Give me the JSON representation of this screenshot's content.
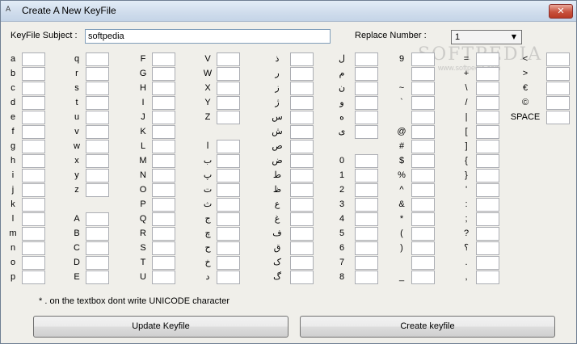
{
  "window": {
    "title": "Create A New KeyFile",
    "close_glyph": "✕",
    "icon_glyph": "A"
  },
  "subject": {
    "label": "KeyFile Subject :",
    "value": "softpedia"
  },
  "replace": {
    "label": "Replace Number :",
    "selected": "1",
    "arrow": "▼"
  },
  "watermark": {
    "text": "SOFTPEDIA",
    "url": "www.softpedia.com"
  },
  "columns": [
    {
      "slots": [
        [
          "a",
          0
        ],
        [
          "b",
          1
        ],
        [
          "c",
          2
        ],
        [
          "d",
          3
        ],
        [
          "e",
          4
        ],
        [
          "f",
          5
        ],
        [
          "g",
          6
        ],
        [
          "h",
          7
        ],
        [
          "i",
          8
        ],
        [
          "j",
          9
        ],
        [
          "k",
          10
        ],
        [
          "l",
          11
        ],
        [
          "m",
          12
        ],
        [
          "n",
          13
        ],
        [
          "o",
          14
        ],
        [
          "p",
          15
        ]
      ]
    },
    {
      "slots": [
        [
          "q",
          0
        ],
        [
          "r",
          1
        ],
        [
          "s",
          2
        ],
        [
          "t",
          3
        ],
        [
          "u",
          4
        ],
        [
          "v",
          5
        ],
        [
          "w",
          6
        ],
        [
          "x",
          7
        ],
        [
          "y",
          8
        ],
        [
          "z",
          9
        ],
        [
          "A",
          11
        ],
        [
          "B",
          12
        ],
        [
          "C",
          13
        ],
        [
          "D",
          14
        ],
        [
          "E",
          15
        ]
      ]
    },
    {
      "slots": [
        [
          "F",
          0
        ],
        [
          "G",
          1
        ],
        [
          "H",
          2
        ],
        [
          "I",
          3
        ],
        [
          "J",
          4
        ],
        [
          "K",
          5
        ],
        [
          "L",
          6
        ],
        [
          "M",
          7
        ],
        [
          "N",
          8
        ],
        [
          "O",
          9
        ],
        [
          "P",
          10
        ],
        [
          "Q",
          11
        ],
        [
          "R",
          12
        ],
        [
          "S",
          13
        ],
        [
          "T",
          14
        ],
        [
          "U",
          15
        ]
      ]
    },
    {
      "slots": [
        [
          "V",
          0
        ],
        [
          "W",
          1
        ],
        [
          "X",
          2
        ],
        [
          "Y",
          3
        ],
        [
          "Z",
          4
        ],
        [
          "ا",
          6
        ],
        [
          "ب",
          7
        ],
        [
          "پ",
          8
        ],
        [
          "ت",
          9
        ],
        [
          "ث",
          10
        ],
        [
          "ج",
          11
        ],
        [
          "چ",
          12
        ],
        [
          "ح",
          13
        ],
        [
          "خ",
          14
        ],
        [
          "د",
          15
        ]
      ]
    },
    {
      "slots": [
        [
          "ذ",
          0
        ],
        [
          "ر",
          1
        ],
        [
          "ز",
          2
        ],
        [
          "ژ",
          3
        ],
        [
          "س",
          4
        ],
        [
          "ش",
          5
        ],
        [
          "ص",
          6
        ],
        [
          "ض",
          7
        ],
        [
          "ط",
          8
        ],
        [
          "ظ",
          9
        ],
        [
          "ع",
          10
        ],
        [
          "غ",
          11
        ],
        [
          "ف",
          12
        ],
        [
          "ق",
          13
        ],
        [
          "ک",
          14
        ],
        [
          "گ",
          15
        ]
      ]
    },
    {
      "slots": [
        [
          "ل",
          0
        ],
        [
          "م",
          1
        ],
        [
          "ن",
          2
        ],
        [
          "و",
          3
        ],
        [
          "ه",
          4
        ],
        [
          "ی",
          5
        ],
        [
          "0",
          7
        ],
        [
          "1",
          8
        ],
        [
          "2",
          9
        ],
        [
          "3",
          10
        ],
        [
          "4",
          11
        ],
        [
          "5",
          12
        ],
        [
          "6",
          13
        ],
        [
          "7",
          14
        ],
        [
          "8",
          15
        ]
      ]
    },
    {
      "slots": [
        [
          "9",
          0
        ],
        [
          "",
          1
        ],
        [
          "~",
          2
        ],
        [
          "`",
          3
        ],
        [
          "",
          4
        ],
        [
          "@",
          5
        ],
        [
          "#",
          6
        ],
        [
          "$",
          7
        ],
        [
          "%",
          8
        ],
        [
          "^",
          9
        ],
        [
          "&",
          10
        ],
        [
          "*",
          11
        ],
        [
          "(",
          12
        ],
        [
          ")",
          13
        ],
        [
          "",
          14
        ],
        [
          "_",
          15
        ]
      ]
    },
    {
      "slots": [
        [
          "=",
          0
        ],
        [
          "+",
          1
        ],
        [
          "\\",
          2
        ],
        [
          "/",
          3
        ],
        [
          "|",
          4
        ],
        [
          "[",
          5
        ],
        [
          "]",
          6
        ],
        [
          "{",
          7
        ],
        [
          "}",
          8
        ],
        [
          "'",
          9
        ],
        [
          ":",
          10
        ],
        [
          ";",
          11
        ],
        [
          "?",
          12
        ],
        [
          "؟",
          13
        ],
        [
          ".",
          14
        ],
        [
          ",",
          15
        ]
      ]
    },
    {
      "slots": [
        [
          "<",
          0
        ],
        [
          ">",
          1
        ],
        [
          "€",
          2
        ],
        [
          "©",
          3
        ],
        [
          "SPACE",
          4
        ]
      ]
    }
  ],
  "note": "* . on the textbox dont write UNICODE character",
  "buttons": {
    "update": "Update Keyfile",
    "create": "Create keyfile"
  }
}
